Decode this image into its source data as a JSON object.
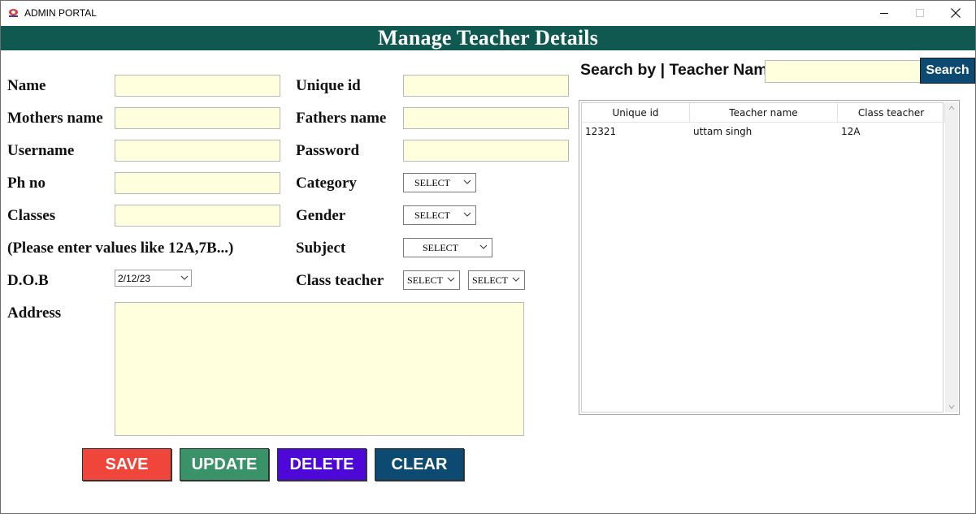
{
  "window": {
    "title": "ADMIN PORTAL"
  },
  "header": {
    "title": "Manage Teacher Details"
  },
  "form": {
    "labels": {
      "name": "Name",
      "mothers_name": "Mothers name",
      "username": "Username",
      "ph_no": "Ph no",
      "classes": "Classes",
      "classes_hint": "(Please enter values like 12A,7B...)",
      "dob": "D.O.B",
      "address": "Address",
      "unique_id": "Unique id",
      "fathers_name": "Fathers name",
      "password": "Password",
      "category": "Category",
      "gender": "Gender",
      "subject": "Subject",
      "class_teacher": "Class teacher"
    },
    "values": {
      "name": "",
      "mothers_name": "",
      "username": "",
      "ph_no": "",
      "classes": "",
      "unique_id": "",
      "fathers_name": "",
      "password": "",
      "address": ""
    },
    "dob_value": "2/12/23",
    "category_selected": "SELECT",
    "gender_selected": "SELECT",
    "subject_selected": "SELECT",
    "class_teacher_selected_1": "SELECT",
    "class_teacher_selected_2": "SELECT"
  },
  "buttons": {
    "save": "SAVE",
    "update": "UPDATE",
    "delete": "DELETE",
    "clear": "CLEAR"
  },
  "colors": {
    "save": "#f0453a",
    "update": "#3a9268",
    "delete": "#4d07d6",
    "clear": "#0d4a72",
    "header": "#0f5950",
    "field": "#ffffdd"
  },
  "search": {
    "label": "Search by | Teacher Name",
    "value": "",
    "button": "Search"
  },
  "table": {
    "columns": [
      "Unique id",
      "Teacher name",
      "Class teacher"
    ],
    "rows": [
      [
        "12321",
        "uttam singh",
        "12A"
      ]
    ]
  }
}
